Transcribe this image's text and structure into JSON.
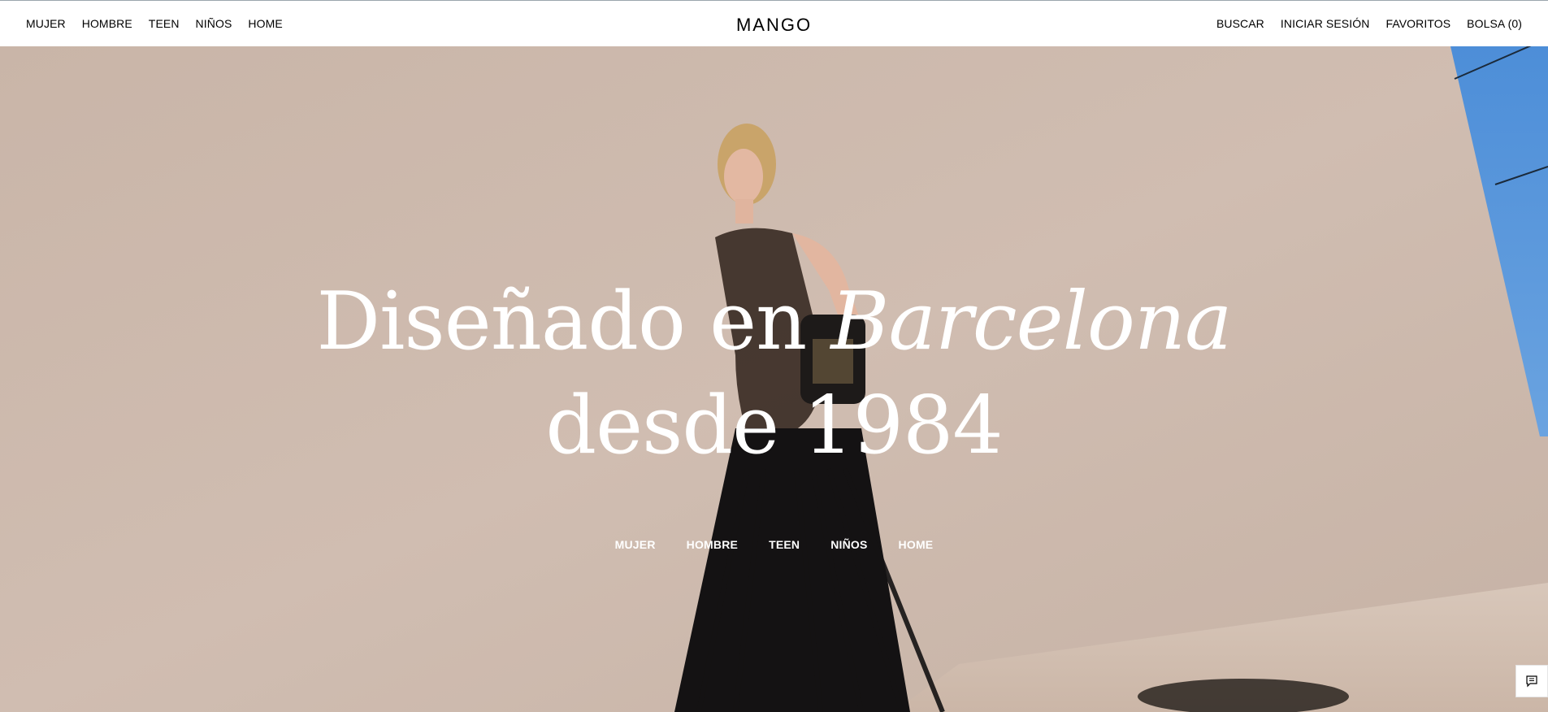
{
  "header": {
    "logo": "MANGO",
    "left_nav": [
      "MUJER",
      "HOMBRE",
      "TEEN",
      "NIÑOS",
      "HOME"
    ],
    "right_nav": [
      "BUSCAR",
      "INICIAR SESIÓN",
      "FAVORITOS",
      "BOLSA (0)"
    ]
  },
  "hero": {
    "headline_line1_plain": "Diseñado en ",
    "headline_line1_italic": "Barcelona",
    "headline_line2": "desde 1984",
    "nav": [
      "MUJER",
      "HOMBRE",
      "TEEN",
      "NIÑOS",
      "HOME"
    ]
  },
  "chat": {
    "icon": "chat-icon"
  },
  "colors": {
    "header_bg": "#ffffff",
    "hero_wall": "#cdb9ac",
    "hero_text": "#ffffff",
    "sky": "#4f8fd6"
  }
}
